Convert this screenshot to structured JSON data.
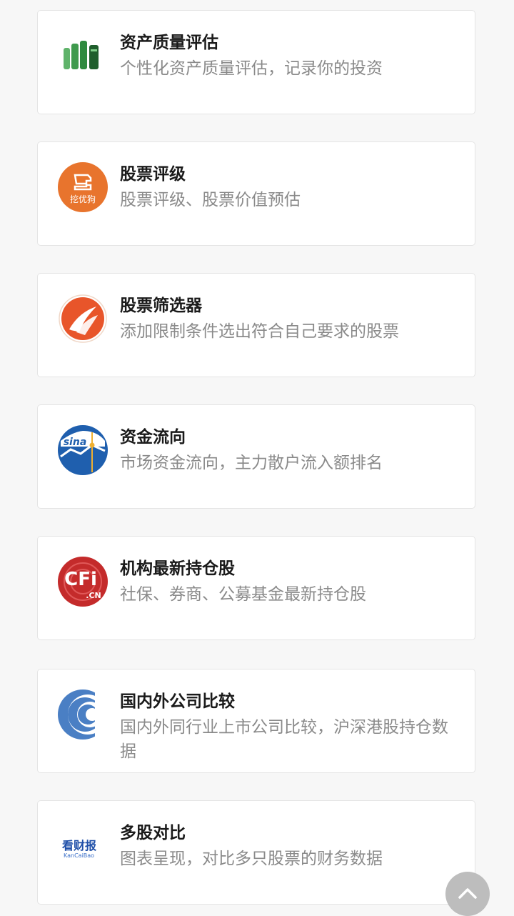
{
  "tools": [
    {
      "title": "资产质量评估",
      "desc": "个性化资产质量评估，记录你的投资",
      "icon": "books-icon"
    },
    {
      "title": "股票评级",
      "desc": "股票评级、股票价值预估",
      "icon": "wayoogou-logo",
      "logo_text": "挖优狗"
    },
    {
      "title": "股票筛选器",
      "desc": "添加限制条件选出符合自己要求的股票",
      "icon": "flame-logo"
    },
    {
      "title": "资金流向",
      "desc": "市场资金流向，主力散户流入额排名",
      "icon": "sina-logo",
      "logo_text": "sina"
    },
    {
      "title": "机构最新持仓股",
      "desc": "社保、券商、公募基金最新持仓股",
      "icon": "cfi-logo",
      "logo_text": "CFi",
      "logo_subtext": ".CN"
    },
    {
      "title": "国内外公司比较",
      "desc": "国内外同行业上市公司比较，沪深港股持仓数据",
      "icon": "arcs-logo"
    },
    {
      "title": "多股对比",
      "desc": "图表呈现，对比多只股票的财务数据",
      "icon": "kancaibao-logo",
      "logo_text": "看财报",
      "logo_subtext": "KanCaiBao"
    }
  ],
  "colors": {
    "background": "#f7f7f7",
    "card": "#ffffff",
    "title": "#1a1a1a",
    "desc": "#8a8a8a"
  },
  "scroll_top_icon": "chevron-up-icon"
}
